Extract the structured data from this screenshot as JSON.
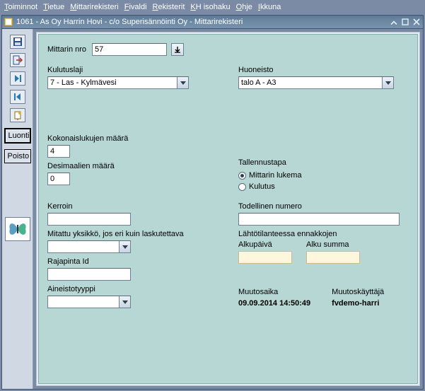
{
  "menu": {
    "items": [
      "Toiminnot",
      "Tietue",
      "Mittarirekisteri",
      "Fivaldi",
      "Rekisterit",
      "KH isohaku",
      "Ohje",
      "Ikkuna"
    ],
    "underline_index": [
      0,
      0,
      0,
      0,
      0,
      0,
      0,
      0
    ]
  },
  "window": {
    "title": "1061 - As Oy Harrin Hovi - c/o Superisännöinti Oy - Mittarirekisteri"
  },
  "sidebar": {
    "luonti": "Luonti",
    "poisto": "Poisto"
  },
  "top": {
    "mittarin_nro_label": "Mittarin nro",
    "mittarin_nro_value": "57"
  },
  "combos": {
    "kulutuslaji_label": "Kulutuslaji",
    "kulutuslaji_value": "7 - Las - Kylmävesi",
    "huoneisto_label": "Huoneisto",
    "huoneisto_value": "talo A - A3"
  },
  "numbers": {
    "kokonaislukujen_label": "Kokonaislukujen määrä",
    "kokonaislukujen_value": "4",
    "desimaalien_label": "Desimaalien määrä",
    "desimaalien_value": "0"
  },
  "tallennus": {
    "label": "Tallennustapa",
    "opt1": "Mittarin lukema",
    "opt2": "Kulutus",
    "selected": 0
  },
  "left": {
    "kerroin_label": "Kerroin",
    "kerroin_value": "",
    "mitattu_label": "Mitattu yksikkö, jos eri kuin laskutettava",
    "mitattu_value": "",
    "rajapinta_label": "Rajapinta Id",
    "rajapinta_value": "",
    "aineisto_label": "Aineistotyyppi",
    "aineisto_value": ""
  },
  "right": {
    "todellinen_label": "Todellinen numero",
    "todellinen_value": "",
    "lahto_label": "Lähtötilanteessa ennakkojen",
    "alkupv_label": "Alkupäivä",
    "alkupv_value": "",
    "alkusumma_label": "Alku summa",
    "alkusumma_value": ""
  },
  "footer": {
    "muutosaika_label": "Muutosaika",
    "muutosaika_value": "09.09.2014 14:50:49",
    "muutoskayttaja_label": "Muutoskäyttäjä",
    "muutoskayttaja_value": "fvdemo-harri"
  }
}
